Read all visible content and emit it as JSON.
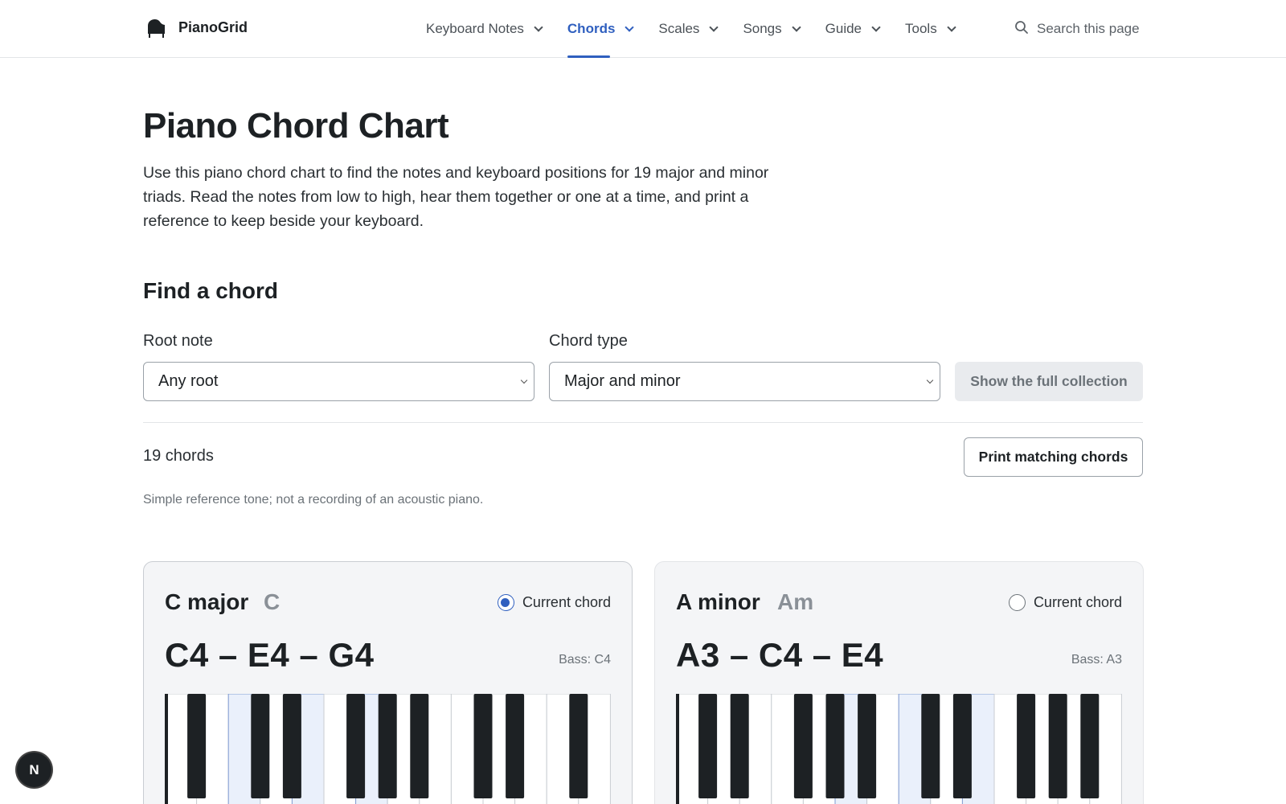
{
  "brand": {
    "name": "PianoGrid",
    "icon": "grand-piano-icon"
  },
  "nav": {
    "items": [
      {
        "label": "Keyboard Notes",
        "active": false
      },
      {
        "label": "Chords",
        "active": true
      },
      {
        "label": "Scales",
        "active": false
      },
      {
        "label": "Songs",
        "active": false
      },
      {
        "label": "Guide",
        "active": false
      },
      {
        "label": "Tools",
        "active": false
      }
    ],
    "search_label": "Search this page"
  },
  "page": {
    "title": "Piano Chord Chart",
    "intro": "Use this piano chord chart to find the notes and keyboard positions for 19 major and minor triads. Read the notes from low to high, hear them together or one at a time, and print a reference to keep beside your keyboard."
  },
  "finder": {
    "title": "Find a chord",
    "root_label": "Root note",
    "root_value": "Any root",
    "type_label": "Chord type",
    "type_value": "Major and minor",
    "collection_button": "Show the full collection",
    "count": "19 chords",
    "print_button": "Print matching chords",
    "note": "Simple reference tone; not a recording of an acoustic piano."
  },
  "cards": [
    {
      "name": "C major",
      "symbol": "C",
      "radio_label": "Current chord",
      "selected": true,
      "notes": "C4 – E4 – G4",
      "bass": "Bass: C4"
    },
    {
      "name": "A minor",
      "symbol": "Am",
      "radio_label": "Current chord",
      "selected": false,
      "notes": "A3 – C4 – E4",
      "bass": "Bass: A3"
    }
  ],
  "colors": {
    "accent": "#2f5fbf",
    "highlight_key": "#eaf0fb"
  },
  "fab_label": "N"
}
